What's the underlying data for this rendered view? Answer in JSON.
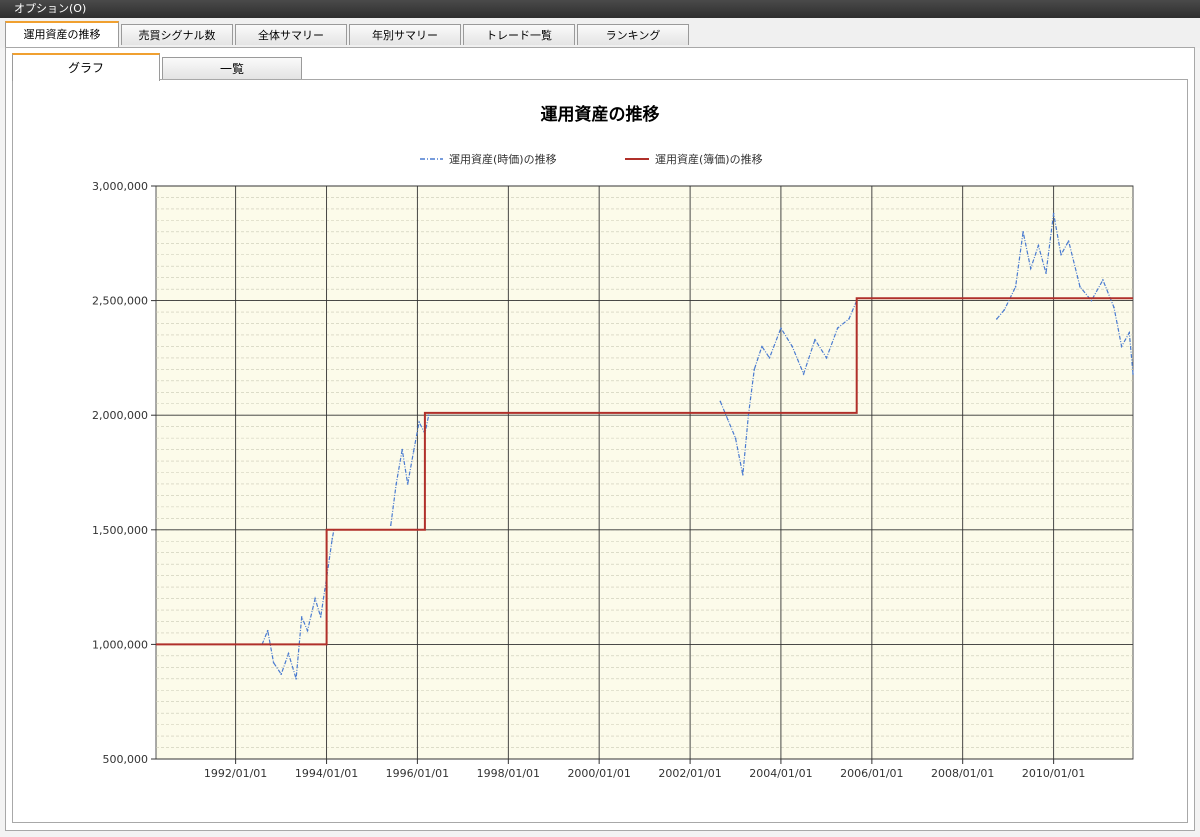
{
  "menu": {
    "options_label": "オプション(O)"
  },
  "tabs": [
    {
      "label": "運用資産の推移",
      "active": true
    },
    {
      "label": "売買シグナル数",
      "active": false
    },
    {
      "label": "全体サマリー",
      "active": false
    },
    {
      "label": "年別サマリー",
      "active": false
    },
    {
      "label": "トレード一覧",
      "active": false
    },
    {
      "label": "ランキング",
      "active": false
    }
  ],
  "subtabs": [
    {
      "label": "グラフ",
      "active": true
    },
    {
      "label": "一覧",
      "active": false
    }
  ],
  "colors": {
    "plot_bg": "#fcfbea",
    "market_series": "#4a7bd0",
    "book_series": "#b0302a",
    "active_tab_accent": "#f0a030"
  },
  "chart_data": {
    "type": "line",
    "title": "運用資産の推移",
    "xlabel": "",
    "ylabel": "",
    "ylim": [
      500000,
      3000000
    ],
    "xlim": [
      "1990/04/01",
      "2011/10/01"
    ],
    "y_ticks": [
      "500,000",
      "1,000,000",
      "1,500,000",
      "2,000,000",
      "2,500,000",
      "3,000,000"
    ],
    "x_ticks": [
      "1992/01/01",
      "1994/01/01",
      "1996/01/01",
      "1998/01/01",
      "2000/01/01",
      "2002/01/01",
      "2004/01/01",
      "2006/01/01",
      "2008/01/01",
      "2010/01/01"
    ],
    "grid": true,
    "legend_position": "top",
    "series": [
      {
        "name": "運用資産(時価)の推移",
        "style": "dash-dot",
        "segments": [
          [
            [
              "1992/08/01",
              1000000
            ],
            [
              "1992/09/15",
              1060000
            ],
            [
              "1992/11/01",
              920000
            ],
            [
              "1993/01/01",
              870000
            ],
            [
              "1993/03/01",
              960000
            ],
            [
              "1993/05/01",
              850000
            ],
            [
              "1993/06/15",
              1120000
            ],
            [
              "1993/08/01",
              1060000
            ],
            [
              "1993/10/01",
              1200000
            ],
            [
              "1993/11/15",
              1120000
            ],
            [
              "1994/01/01",
              1290000
            ],
            [
              "1994/02/15",
              1460000
            ],
            [
              "1994/03/01",
              1500000
            ]
          ],
          [
            [
              "1995/06/01",
              1520000
            ],
            [
              "1995/07/15",
              1700000
            ],
            [
              "1995/09/01",
              1850000
            ],
            [
              "1995/10/15",
              1700000
            ],
            [
              "1995/12/01",
              1840000
            ],
            [
              "1996/01/15",
              1970000
            ],
            [
              "1996/03/01",
              1920000
            ],
            [
              "1996/04/01",
              2000000
            ]
          ],
          [
            [
              "2002/09/01",
              2060000
            ],
            [
              "2002/11/01",
              1980000
            ],
            [
              "2003/01/01",
              1900000
            ],
            [
              "2003/03/01",
              1740000
            ],
            [
              "2003/04/15",
              2000000
            ],
            [
              "2003/06/01",
              2200000
            ],
            [
              "2003/08/01",
              2300000
            ],
            [
              "2003/10/01",
              2250000
            ],
            [
              "2004/01/01",
              2380000
            ],
            [
              "2004/04/01",
              2300000
            ],
            [
              "2004/07/01",
              2180000
            ],
            [
              "2004/10/01",
              2330000
            ],
            [
              "2005/01/01",
              2250000
            ],
            [
              "2005/04/01",
              2380000
            ],
            [
              "2005/07/01",
              2420000
            ],
            [
              "2005/09/01",
              2500000
            ]
          ],
          [
            [
              "2008/10/01",
              2420000
            ],
            [
              "2008/12/01",
              2460000
            ],
            [
              "2009/03/01",
              2560000
            ],
            [
              "2009/05/01",
              2800000
            ],
            [
              "2009/07/01",
              2640000
            ],
            [
              "2009/09/01",
              2740000
            ],
            [
              "2009/11/01",
              2620000
            ],
            [
              "2010/01/01",
              2880000
            ],
            [
              "2010/03/01",
              2700000
            ],
            [
              "2010/05/01",
              2760000
            ],
            [
              "2010/08/01",
              2560000
            ],
            [
              "2010/11/01",
              2500000
            ],
            [
              "2011/02/01",
              2590000
            ],
            [
              "2011/05/01",
              2470000
            ],
            [
              "2011/07/01",
              2300000
            ],
            [
              "2011/09/01",
              2360000
            ],
            [
              "2011/10/01",
              2180000
            ]
          ]
        ]
      },
      {
        "name": "運用資産(簿価)の推移",
        "style": "solid",
        "points": [
          [
            "1990/04/01",
            1000000
          ],
          [
            "1994/01/01",
            1000000
          ],
          [
            "1994/01/01",
            1500000
          ],
          [
            "1996/03/01",
            1500000
          ],
          [
            "1996/03/01",
            2010000
          ],
          [
            "2005/09/01",
            2010000
          ],
          [
            "2005/09/01",
            2510000
          ],
          [
            "2011/10/01",
            2510000
          ]
        ]
      }
    ]
  }
}
